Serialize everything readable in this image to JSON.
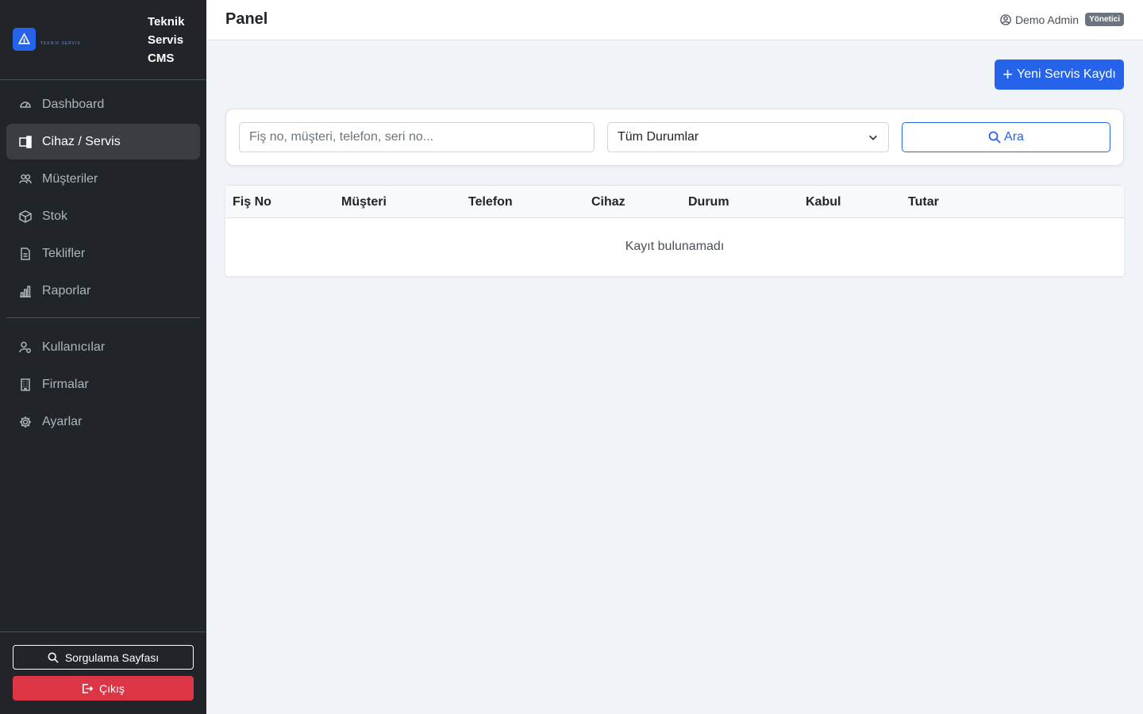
{
  "brand": {
    "title": "Teknik Servis CMS",
    "logo_tag": "TEKNIK SERVIS",
    "accent": "#2563eb"
  },
  "sidebar": {
    "items": [
      {
        "label": "Dashboard",
        "icon": "speedometer-icon",
        "active": false
      },
      {
        "label": "Cihaz / Servis",
        "icon": "devices-icon",
        "active": true
      },
      {
        "label": "Müşteriler",
        "icon": "people-icon",
        "active": false
      },
      {
        "label": "Stok",
        "icon": "box-icon",
        "active": false
      },
      {
        "label": "Teklifler",
        "icon": "document-icon",
        "active": false
      },
      {
        "label": "Raporlar",
        "icon": "bar-chart-icon",
        "active": false
      }
    ],
    "admin_items": [
      {
        "label": "Kullanıcılar",
        "icon": "person-gear-icon"
      },
      {
        "label": "Firmalar",
        "icon": "building-icon"
      },
      {
        "label": "Ayarlar",
        "icon": "gear-icon"
      }
    ],
    "query_button": "Sorgulama Sayfası",
    "logout_button": "Çıkış"
  },
  "header": {
    "title": "Panel",
    "user_name": "Demo Admin",
    "role_badge": "Yönetici"
  },
  "actions": {
    "new_record": "Yeni Servis Kaydı"
  },
  "filters": {
    "search_placeholder": "Fiş no, müşteri, telefon, seri no...",
    "status_selected": "Tüm Durumlar",
    "search_button": "Ara"
  },
  "table": {
    "columns": [
      "Fiş No",
      "Müşteri",
      "Telefon",
      "Cihaz",
      "Durum",
      "Kabul",
      "Tutar"
    ],
    "empty_text": "Kayıt bulunamadı"
  },
  "colors": {
    "sidebar_bg": "#212529",
    "primary": "#2563eb",
    "danger": "#dc3545",
    "page_bg": "#f0f3f8"
  }
}
